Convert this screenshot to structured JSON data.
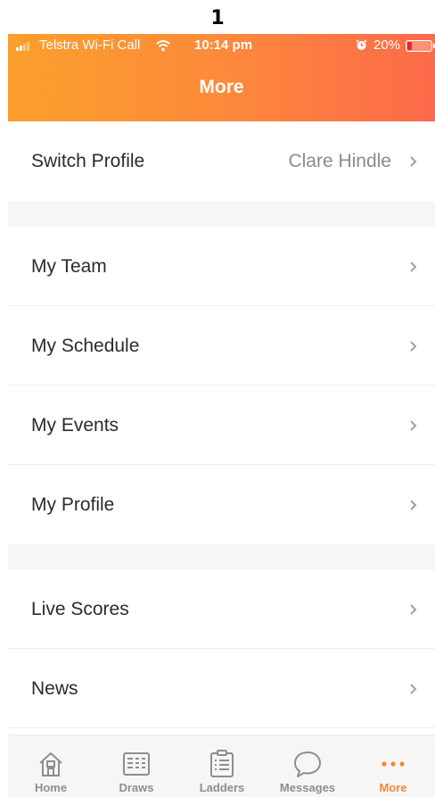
{
  "page_label": "1",
  "status_bar": {
    "carrier": "Telstra Wi-Fi Call",
    "time": "10:14 pm",
    "battery_percent": "20%",
    "battery_level": 0.2,
    "icons": [
      "signal-icon",
      "wifi-icon",
      "alarm-icon",
      "battery-icon"
    ]
  },
  "header": {
    "title": "More",
    "gradient": [
      "#fb9f2c",
      "#fc6a4a"
    ]
  },
  "menu": {
    "switch_profile": {
      "label": "Switch Profile",
      "value": "Clare Hindle"
    },
    "group_1": [
      {
        "label": "My Team"
      },
      {
        "label": "My Schedule"
      },
      {
        "label": "My Events"
      },
      {
        "label": "My Profile"
      }
    ],
    "group_2": [
      {
        "label": "Live Scores"
      },
      {
        "label": "News"
      }
    ]
  },
  "tabbar": {
    "tabs": [
      {
        "label": "Home",
        "icon": "home-icon"
      },
      {
        "label": "Draws",
        "icon": "draws-grid-icon"
      },
      {
        "label": "Ladders",
        "icon": "clipboard-list-icon"
      },
      {
        "label": "Messages",
        "icon": "chat-bubble-icon"
      },
      {
        "label": "More",
        "icon": "more-dots-icon",
        "active": true
      }
    ],
    "active_color": "#f58633",
    "inactive_color": "#8e8e8e"
  }
}
